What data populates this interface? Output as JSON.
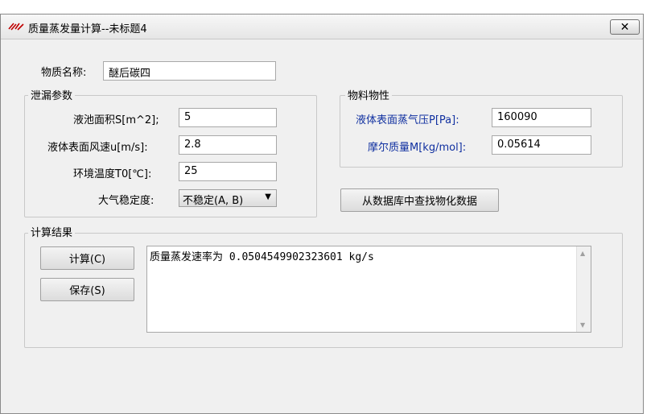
{
  "window": {
    "title": "质量蒸发量计算--未标题4",
    "close_label": "✕"
  },
  "substance": {
    "label": "物质名称:",
    "value": "醚后碳四"
  },
  "leak_params": {
    "title": "泄漏参数",
    "pool_area": {
      "label": "液池面积S[m^2];",
      "value": "5"
    },
    "wind_speed": {
      "label": "液体表面风速u[m/s]:",
      "value": "2.8"
    },
    "ambient_temp": {
      "label": "环境温度T0[℃]:",
      "value": "25"
    },
    "stability": {
      "label": "大气稳定度:",
      "value": "不稳定(A, B)"
    }
  },
  "material_props": {
    "title": "物料物性",
    "vapor_pressure": {
      "label": "液体表面蒸气压P[Pa]:",
      "value": "160090"
    },
    "molar_mass": {
      "label": "摩尔质量M[kg/mol]:",
      "value": "0.05614"
    }
  },
  "lookup_button": "从数据库中查找物化数据",
  "results": {
    "title": "计算结果",
    "calc_button": "计算(C)",
    "save_button": "保存(S)",
    "output": "质量蒸发速率为 0.0504549902323601 kg/s"
  },
  "colors": {
    "blue_label": "#1030a0"
  }
}
